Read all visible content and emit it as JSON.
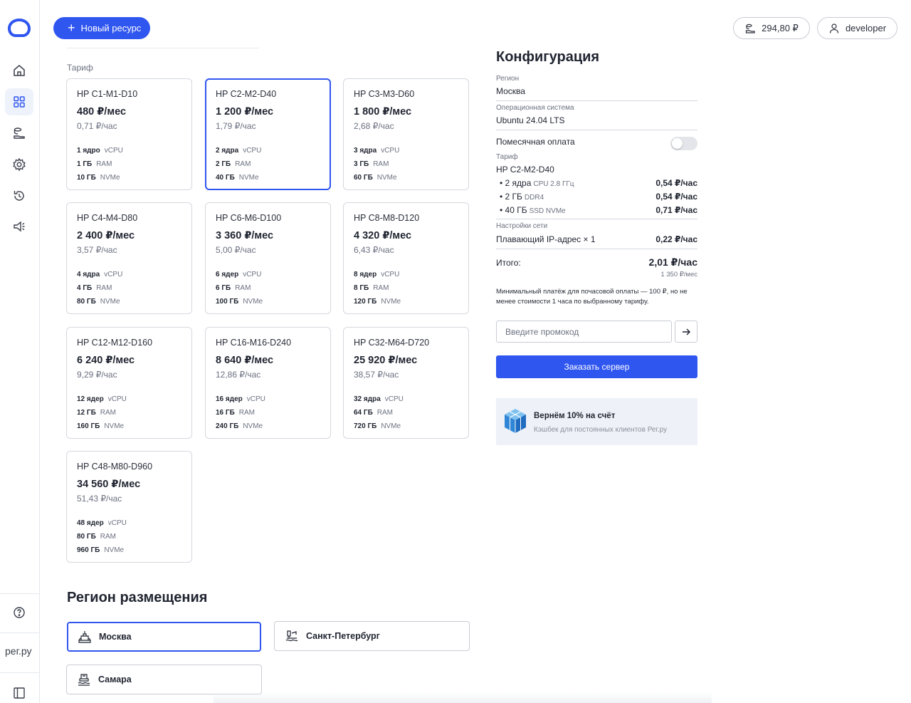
{
  "header": {
    "new_resource_label": "Новый ресурс",
    "balance": "294,80 ₽",
    "user": "developer"
  },
  "sidebar": {
    "brand": "рег.ру",
    "items": [
      {
        "icon": "home-icon"
      },
      {
        "icon": "grid-icon",
        "active": true
      },
      {
        "icon": "billing-icon"
      },
      {
        "icon": "gear-icon"
      },
      {
        "icon": "history-icon"
      },
      {
        "icon": "megaphone-icon"
      }
    ]
  },
  "tariffs": {
    "label": "Тариф",
    "cards": [
      {
        "name": "HP C1-M1-D10",
        "price": "480 ₽/мес",
        "hour": "0,71 ₽/час",
        "cpu": "1 ядро",
        "ram": "1 ГБ",
        "disk": "10 ГБ",
        "cpu_t": "vCPU",
        "ram_t": "RAM",
        "disk_t": "NVMe"
      },
      {
        "name": "HP C2-M2-D40",
        "price": "1 200 ₽/мес",
        "hour": "1,79 ₽/час",
        "cpu": "2 ядра",
        "ram": "2 ГБ",
        "disk": "40 ГБ",
        "cpu_t": "vCPU",
        "ram_t": "RAM",
        "disk_t": "NVMe",
        "selected": true
      },
      {
        "name": "HP C3-M3-D60",
        "price": "1 800 ₽/мес",
        "hour": "2,68 ₽/час",
        "cpu": "3 ядра",
        "ram": "3 ГБ",
        "disk": "60 ГБ",
        "cpu_t": "vCPU",
        "ram_t": "RAM",
        "disk_t": "NVMe"
      },
      {
        "name": "HP C4-M4-D80",
        "price": "2 400 ₽/мес",
        "hour": "3,57 ₽/час",
        "cpu": "4 ядра",
        "ram": "4 ГБ",
        "disk": "80 ГБ",
        "cpu_t": "vCPU",
        "ram_t": "RAM",
        "disk_t": "NVMe"
      },
      {
        "name": "HP C6-M6-D100",
        "price": "3 360 ₽/мес",
        "hour": "5,00 ₽/час",
        "cpu": "6 ядер",
        "ram": "6 ГБ",
        "disk": "100 ГБ",
        "cpu_t": "vCPU",
        "ram_t": "RAM",
        "disk_t": "NVMe"
      },
      {
        "name": "HP C8-M8-D120",
        "price": "4 320 ₽/мес",
        "hour": "6,43 ₽/час",
        "cpu": "8 ядер",
        "ram": "8 ГБ",
        "disk": "120 ГБ",
        "cpu_t": "vCPU",
        "ram_t": "RAM",
        "disk_t": "NVMe"
      },
      {
        "name": "HP C12-M12-D160",
        "price": "6 240 ₽/мес",
        "hour": "9,29 ₽/час",
        "cpu": "12 ядер",
        "ram": "12 ГБ",
        "disk": "160 ГБ",
        "cpu_t": "vCPU",
        "ram_t": "RAM",
        "disk_t": "NVMe"
      },
      {
        "name": "HP C16-M16-D240",
        "price": "8 640 ₽/мес",
        "hour": "12,86 ₽/час",
        "cpu": "16 ядер",
        "ram": "16 ГБ",
        "disk": "240 ГБ",
        "cpu_t": "vCPU",
        "ram_t": "RAM",
        "disk_t": "NVMe"
      },
      {
        "name": "HP C32-M64-D720",
        "price": "25 920 ₽/мес",
        "hour": "38,57 ₽/час",
        "cpu": "32 ядра",
        "ram": "64 ГБ",
        "disk": "720 ГБ",
        "cpu_t": "vCPU",
        "ram_t": "RAM",
        "disk_t": "NVMe"
      },
      {
        "name": "HP C48-M80-D960",
        "price": "34 560 ₽/мес",
        "hour": "51,43 ₽/час",
        "cpu": "48 ядер",
        "ram": "80 ГБ",
        "disk": "960 ГБ",
        "cpu_t": "vCPU",
        "ram_t": "RAM",
        "disk_t": "NVMe"
      }
    ]
  },
  "region": {
    "title": "Регион размещения",
    "options": [
      {
        "label": "Москва",
        "selected": true
      },
      {
        "label": "Санкт-Петербург"
      },
      {
        "label": "Самара"
      }
    ]
  },
  "config": {
    "title": "Конфигурация",
    "region_label": "Регион",
    "region_value": "Москва",
    "os_label": "Операционная система",
    "os_value": "Ubuntu 24.04 LTS",
    "monthly_label": "Помесячная оплата",
    "monthly_enabled": false,
    "tariff_label": "Тариф",
    "tariff_value": "HP C2-M2-D40",
    "lines": [
      {
        "main": "• 2 ядра",
        "sub": "CPU 2.8 ГГц",
        "price": "0,54 ₽/час"
      },
      {
        "main": "• 2 ГБ",
        "sub": "DDR4",
        "price": "0,54 ₽/час"
      },
      {
        "main": "• 40 ГБ",
        "sub": "SSD NVMe",
        "price": "0,71 ₽/час"
      }
    ],
    "network_label": "Настройки сети",
    "network_value": "Плавающий IP-адрес × 1",
    "network_price": "0,22 ₽/час",
    "total_label": "Итого:",
    "total_price": "2,01 ₽/час",
    "total_month": "1 350 ₽/мес",
    "note": "Минимальный платёж для почасовой оплаты — 100 ₽, но не менее стоимости 1 часа по выбранному тарифу.",
    "promo_placeholder": "Введите промокод",
    "order_label": "Заказать сервер",
    "cashback_title": "Вернём 10% на счёт",
    "cashback_sub": "Кэшбек для постоянных клиентов Рег.ру"
  },
  "colors": {
    "accent": "#3056f0",
    "border": "#d5d8df",
    "muted": "#6b7180"
  }
}
